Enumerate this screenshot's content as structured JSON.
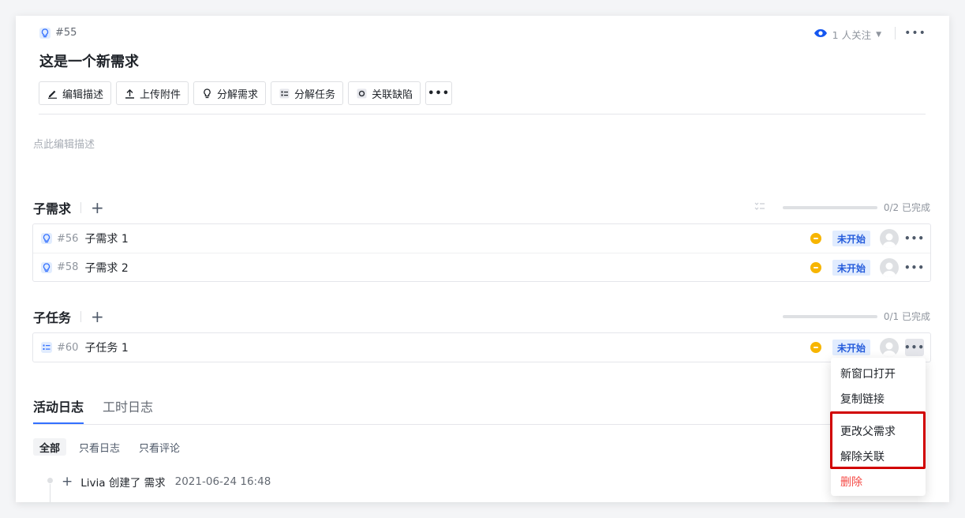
{
  "item": {
    "id": "#55",
    "title": "这是一个新需求"
  },
  "watch": {
    "label": "1 人关注"
  },
  "toolbar": [
    {
      "label": "编辑描述",
      "icon": "pencil-icon"
    },
    {
      "label": "上传附件",
      "icon": "upload-icon"
    },
    {
      "label": "分解需求",
      "icon": "bulb-icon"
    },
    {
      "label": "分解任务",
      "icon": "task-list-icon"
    },
    {
      "label": "关联缺陷",
      "icon": "bug-icon"
    }
  ],
  "description_placeholder": "点此编辑描述",
  "sub_requirements": {
    "title": "子需求",
    "progress_text": "0/2 已完成",
    "progress_fraction": 0,
    "items": [
      {
        "id": "#56",
        "name": "子需求 1",
        "status": "未开始"
      },
      {
        "id": "#58",
        "name": "子需求 2",
        "status": "未开始"
      }
    ]
  },
  "sub_tasks": {
    "title": "子任务",
    "progress_text": "0/1 已完成",
    "progress_fraction": 0,
    "items": [
      {
        "id": "#60",
        "name": "子任务 1",
        "status": "未开始"
      }
    ]
  },
  "tabs": [
    "活动日志",
    "工时日志"
  ],
  "filters": [
    "全部",
    "只看日志",
    "只看评论"
  ],
  "log": {
    "text": "Livia 创建了 需求",
    "time": "2021-06-24 16:48"
  },
  "menu": [
    "新窗口打开",
    "复制链接",
    "更改父需求",
    "解除关联",
    "删除"
  ],
  "colors": {
    "accent": "#3370ff",
    "priority": "#f7b500",
    "status_bg": "#e1ecfe",
    "danger": "#f54a45",
    "highlight": "#d10000"
  }
}
